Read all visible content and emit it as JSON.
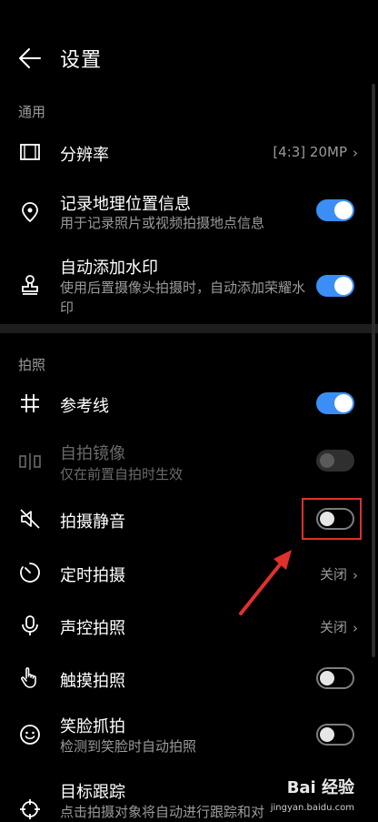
{
  "header": {
    "title": "设置"
  },
  "sections": {
    "general": "通用",
    "photo": "拍照"
  },
  "rows": {
    "resolution": {
      "label": "分辨率",
      "value": "[4:3] 20MP"
    },
    "location": {
      "label": "记录地理位置信息",
      "desc": "用于记录照片或视频拍摄地点信息",
      "state": "on"
    },
    "watermark": {
      "label": "自动添加水印",
      "desc": "使用后置摄像头拍摄时，自动添加荣耀水印",
      "state": "on"
    },
    "gridlines": {
      "label": "参考线",
      "state": "on"
    },
    "selfie_mirror": {
      "label": "自拍镜像",
      "desc": "仅在前置自拍时生效",
      "state": "disabled"
    },
    "mute": {
      "label": "拍摄静音",
      "state": "off"
    },
    "timer": {
      "label": "定时拍摄",
      "value": "关闭"
    },
    "voice": {
      "label": "声控拍照",
      "value": "关闭"
    },
    "touch": {
      "label": "触摸拍照",
      "state": "off"
    },
    "smile": {
      "label": "笑脸抓拍",
      "desc": "检测到笑脸时自动拍照",
      "state": "off"
    },
    "tracking": {
      "label": "目标跟踪",
      "desc": "点击拍摄对象将自动进行跟踪和对"
    }
  },
  "watermark_text": {
    "brand": "Bai 经验",
    "url": "jingyan.baidu.com"
  },
  "colors": {
    "accent": "#3a8ef6",
    "highlight": "#e0312a"
  }
}
